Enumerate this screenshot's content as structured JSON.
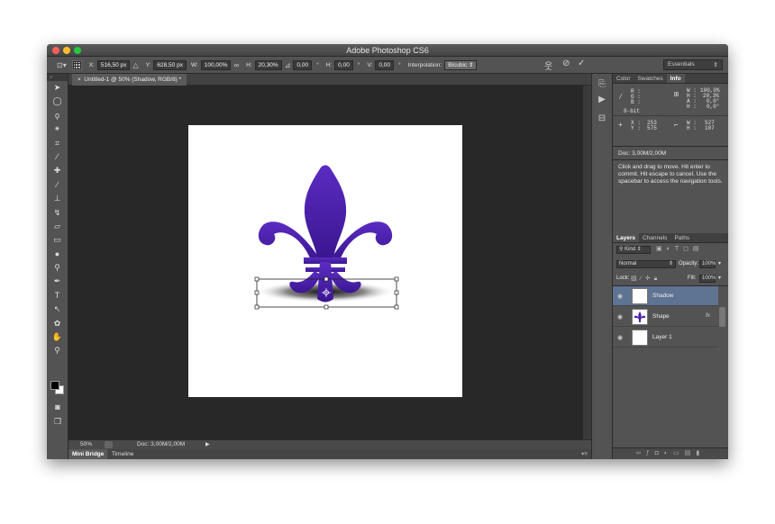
{
  "app": {
    "title": "Adobe Photoshop CS6"
  },
  "options": {
    "x_label": "X:",
    "x_value": "516,50 px",
    "y_label": "Y:",
    "y_value": "628,50 px",
    "w_label": "W:",
    "w_value": "100,00%",
    "h_label": "H:",
    "h_value": "20,30%",
    "angle_value": "0,00",
    "hskew_label": "H:",
    "hskew_value": "0,00",
    "vskew_label": "V:",
    "vskew_value": "0,00",
    "interp_label": "Interpolation:",
    "interp_value": "Bicubic",
    "workspace": "Essentials",
    "degree": "°"
  },
  "document": {
    "tab_title": "Untitled-1 @ 50% (Shadow, RGB/8) *",
    "zoom": "50%",
    "doc_size": "Doc: 3,00M/2,00M"
  },
  "bottom_tabs": [
    "Mini Bridge",
    "Timeline"
  ],
  "info_panel": {
    "tabs": [
      "Color",
      "Swatches",
      "Info"
    ],
    "r": "R :",
    "g": "G :",
    "b": "B :",
    "bit": "8-bit",
    "w_label": "W :",
    "w_value": "100,0%",
    "h_label": "H :",
    "h_value": "20,3%",
    "a_label": "A :",
    "a_value": "0,0°",
    "h2_label": "H :",
    "h2_value": "0,0°",
    "x_label": "X :",
    "x_value": "253",
    "y_label": "Y :",
    "y_value": "575",
    "w2_label": "W :",
    "w2_value": "527",
    "h3_label": "H :",
    "h3_value": "107",
    "doc": "Doc: 3,00M/2,00M",
    "hint": "Click and drag to move. Hit enter to commit. Hit escape to cancel. Use the spacebar to access the navigation tools."
  },
  "layers_panel": {
    "tabs": [
      "Layers",
      "Channels",
      "Paths"
    ],
    "kind": "Kind",
    "blend": "Normal",
    "opacity_label": "Opacity:",
    "opacity_value": "100%",
    "lock_label": "Lock:",
    "fill_label": "Fill:",
    "fill_value": "100%",
    "layers": [
      {
        "name": "Shadow",
        "selected": true
      },
      {
        "name": "Shape",
        "fx": "fx"
      },
      {
        "name": "Layer 1"
      }
    ]
  },
  "colors": {
    "accent": "#4a1fa8",
    "selected_layer": "#5f7392"
  }
}
